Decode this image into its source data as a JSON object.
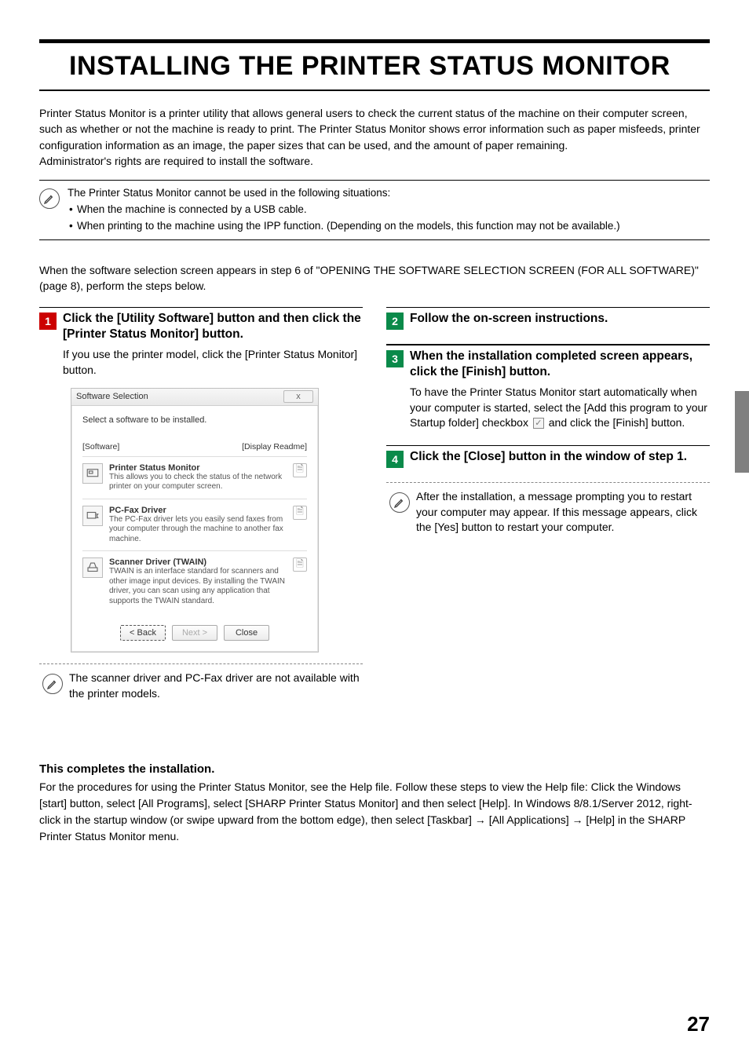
{
  "page": {
    "title": "INSTALLING THE PRINTER STATUS MONITOR",
    "page_number": "27"
  },
  "intro": {
    "p1": "Printer Status Monitor is a printer utility that allows general users to check the current status of the machine on their computer screen, such as whether or not the machine is ready to print. The Printer Status Monitor shows error information such as paper misfeeds, printer configuration information as an image, the paper sizes that can be used, and the amount of paper remaining.",
    "p2": "Administrator's rights are required to install the software."
  },
  "note_top": {
    "line1": "The Printer Status Monitor cannot be used in the following situations:",
    "b1": "When the machine is connected by a USB cable.",
    "b2": "When printing to the machine using the IPP function. (Depending on the models,  this function may not be available.)"
  },
  "callout": "When the software selection screen appears in step 6 of \"OPENING THE SOFTWARE SELECTION SCREEN (FOR ALL SOFTWARE)\" (page 8), perform the steps below.",
  "steps": {
    "s1": {
      "num": "1",
      "title": "Click the [Utility Software] button and then click the [Printer Status Monitor] button.",
      "body": "If you use the printer model, click the [Printer Status Monitor] button."
    },
    "s2": {
      "num": "2",
      "title": "Follow the on-screen instructions."
    },
    "s3": {
      "num": "3",
      "title": "When the installation completed screen appears, click the [Finish] button.",
      "body_a": "To have the Printer Status Monitor start automatically when your computer is started, select the [Add this program to your Startup folder] checkbox ",
      "body_b": " and click the [Finish] button."
    },
    "s4": {
      "num": "4",
      "title": "Click the [Close] button in the window of step 1."
    }
  },
  "dialog": {
    "title": "Software Selection",
    "close_x": "x",
    "instruction": "Select a software to be installed.",
    "col_left": "[Software]",
    "col_right": "[Display Readme]",
    "items": [
      {
        "name": "Printer Status Monitor",
        "desc": "This allows you to check the status of the network printer on your computer screen."
      },
      {
        "name": "PC-Fax Driver",
        "desc": "The PC-Fax driver lets you easily send faxes from your computer through the machine to another fax machine."
      },
      {
        "name": "Scanner Driver (TWAIN)",
        "desc": "TWAIN is an interface standard for scanners and other image input devices. By installing the TWAIN driver, you can scan using any application that supports the TWAIN standard."
      }
    ],
    "btn_back": "< Back",
    "btn_next": "Next >",
    "btn_close": "Close"
  },
  "note_left": "The scanner driver and PC-Fax driver are not available with the printer models.",
  "note_right": "After the installation, a message prompting you to restart your computer may appear. If this message appears, click the [Yes] button to restart your computer.",
  "finish": {
    "title": "This completes the installation.",
    "body": "For the procedures for using the Printer Status Monitor, see the Help file. Follow these steps to view the Help file:\nClick the Windows [start] button, select [All Programs], select [SHARP Printer Status Monitor] and then select [Help]. In Windows 8/8.1/Server 2012, right-click in the startup window (or swipe upward from the bottom edge), then select [Taskbar] → [All Applications] → [Help] in the SHARP Printer Status Monitor menu."
  }
}
